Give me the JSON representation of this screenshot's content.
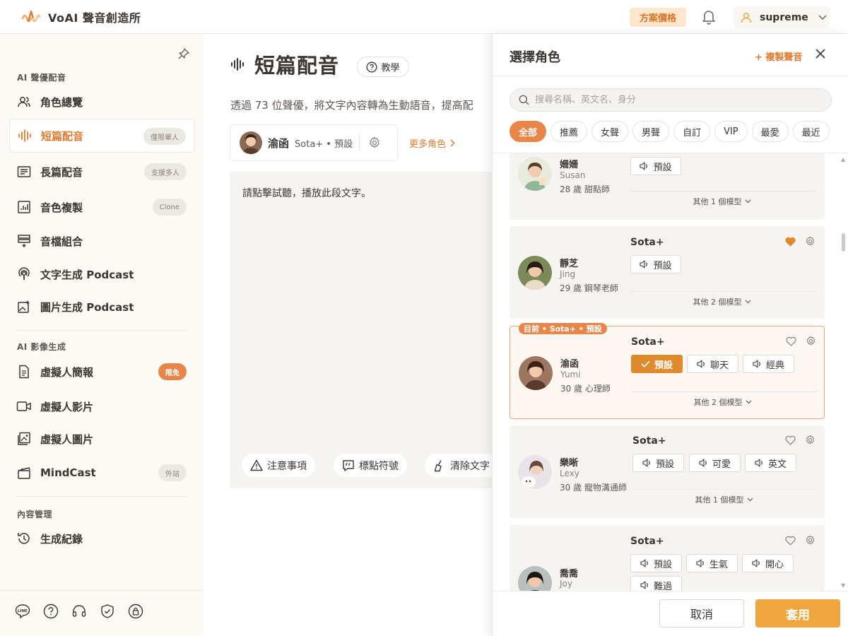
{
  "app": {
    "name": "VoAI 聲音創造所",
    "logo_icon": "voai-wave-logo"
  },
  "topbar": {
    "plan_label": "方案價格",
    "bell_icon": "bell-icon",
    "user": {
      "name": "supreme",
      "icon": "user-icon"
    }
  },
  "colors": {
    "accent": "#e8864a",
    "accent_text": "#e07b2e",
    "apply": "#f0a63e",
    "sidebar_bg": "#fdf9f4"
  },
  "sidebar": {
    "sections": [
      {
        "title": "AI 聲優配音",
        "items": [
          {
            "label": "角色總覽",
            "icon": "users-icon"
          },
          {
            "label": "短篇配音",
            "icon": "waveform-icon",
            "badge": "僅限單人",
            "active": true
          },
          {
            "label": "長篇配音",
            "icon": "document-list-icon",
            "badge": "支援多人"
          },
          {
            "label": "音色複製",
            "icon": "voice-clone-icon",
            "badge": "Clone"
          },
          {
            "label": "音檔組合",
            "icon": "audio-merge-icon"
          },
          {
            "label": "文字生成 Podcast",
            "icon": "podcast-icon"
          },
          {
            "label": "圖片生成 Podcast",
            "icon": "image-podcast-icon"
          }
        ]
      },
      {
        "title": "AI 影像生成",
        "items": [
          {
            "label": "虛擬人簡報",
            "icon": "presentation-icon",
            "badge": "限免"
          },
          {
            "label": "虛擬人影片",
            "icon": "video-icon"
          },
          {
            "label": "虛擬人圖片",
            "icon": "image-icon"
          },
          {
            "label": "MindCast",
            "icon": "clapper-icon",
            "badge": "外站"
          }
        ]
      },
      {
        "title": "內容管理",
        "items": [
          {
            "label": "生成紀錄",
            "icon": "history-icon"
          }
        ]
      }
    ],
    "footer_icons": [
      "line-icon",
      "help-icon",
      "headset-icon",
      "shield-icon",
      "lock-icon"
    ]
  },
  "main": {
    "title": "短篇配音",
    "tutorial_label": "教學",
    "description": "透過 73 位聲優，將文字內容轉為生動語音，提高配",
    "voice": {
      "name": "渝函",
      "meta": "Sota+ • 預設"
    },
    "more_roles": "更多角色",
    "editor_text": "請點擊試聽，播放此段文字。",
    "tools": [
      "注意事項",
      "標點符號",
      "清除文字"
    ]
  },
  "panel": {
    "title": "選擇角色",
    "copy_voice": "+ 複製聲音",
    "search_placeholder": "搜尋名稱、英文名、身分",
    "filters": [
      "全部",
      "推薦",
      "女聲",
      "男聲",
      "自訂",
      "VIP",
      "最愛",
      "最近"
    ],
    "cards": [
      {
        "name": "姍姍",
        "eng": "Susan",
        "info": "28 歲 甜點師",
        "model": "",
        "buttons": [
          "預設"
        ],
        "more": "其他 1 個模型",
        "favorite": false
      },
      {
        "name": "靜芝",
        "eng": "Jing",
        "info": "29 歲 鋼琴老師",
        "model": "Sota+",
        "buttons": [
          "預設"
        ],
        "more": "其他 2 個模型",
        "favorite": true
      },
      {
        "name": "渝函",
        "eng": "Yumi",
        "info": "30 歲 心理師",
        "model": "Sota+",
        "buttons": [
          "預設",
          "聊天",
          "經典"
        ],
        "more": "其他 2 個模型",
        "favorite": false,
        "selected": true,
        "tag": "目前 • Sota+ • 預設"
      },
      {
        "name": "樂晰",
        "eng": "Lexy",
        "info": "30 歲 寵物溝通師",
        "model": "Sota+",
        "buttons": [
          "預設",
          "可愛",
          "英文"
        ],
        "more": "其他 1 個模型",
        "favorite": false
      },
      {
        "name": "喬喬",
        "eng": "Joy",
        "info": "",
        "model": "Sota+",
        "buttons": [
          "預設",
          "生氣",
          "開心",
          "難過"
        ],
        "more": "",
        "favorite": false
      }
    ],
    "cancel_label": "取消",
    "apply_label": "套用"
  }
}
